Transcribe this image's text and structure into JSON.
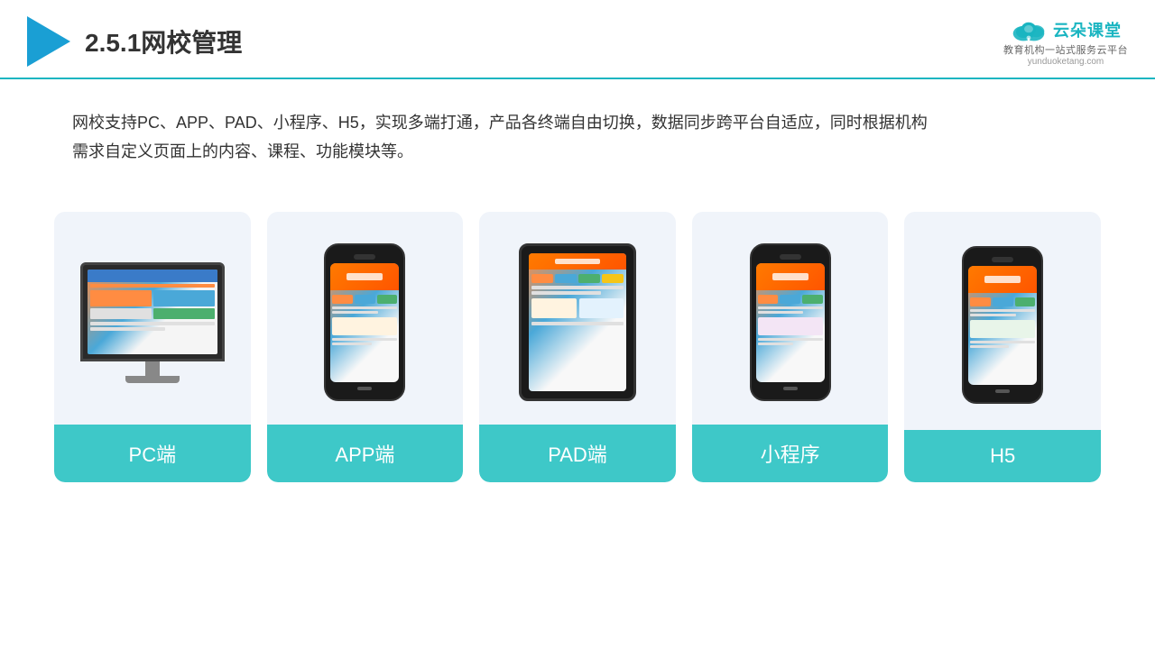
{
  "header": {
    "title": "2.5.1网校管理",
    "brand_name": "云朵课堂",
    "brand_url": "yunduoketang.com",
    "brand_tagline": "教育机构一站\n式服务云平台"
  },
  "description": {
    "text": "网校支持PC、APP、PAD、小程序、H5，实现多端打通，产品各终端自由切换，数据同步跨平台自适应，同时根据机构需求自定义页面上的内容、课程、功能模块等。"
  },
  "cards": [
    {
      "id": "pc",
      "label": "PC端"
    },
    {
      "id": "app",
      "label": "APP端"
    },
    {
      "id": "pad",
      "label": "PAD端"
    },
    {
      "id": "miniprogram",
      "label": "小程序"
    },
    {
      "id": "h5",
      "label": "H5"
    }
  ],
  "accent_color": "#3ec8c8"
}
